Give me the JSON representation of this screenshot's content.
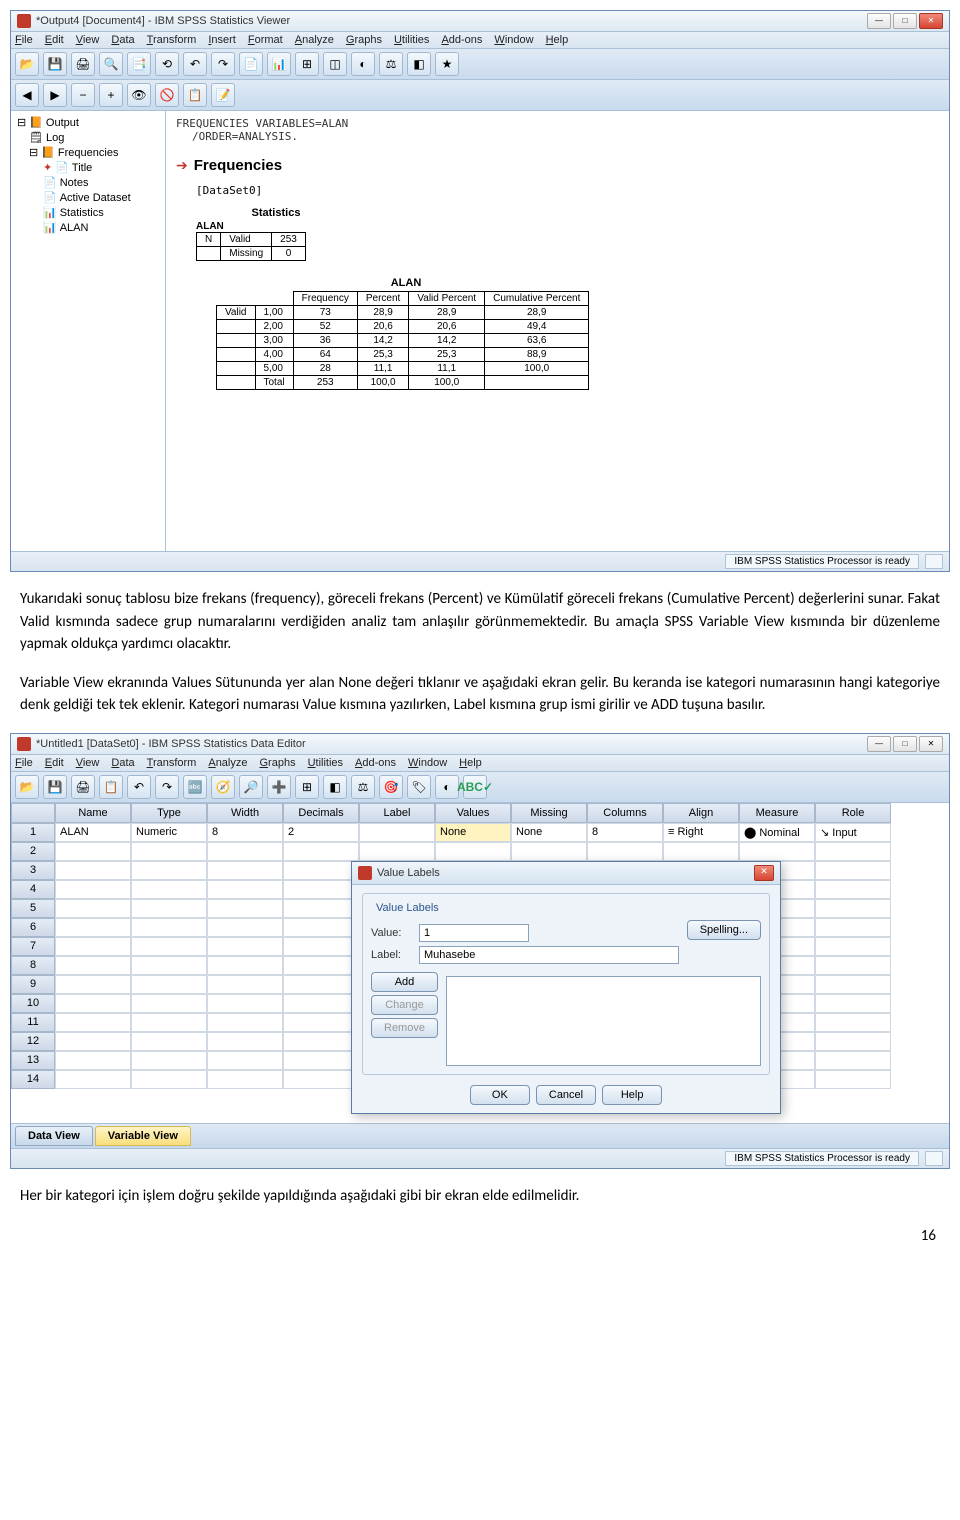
{
  "viewer": {
    "title": "*Output4 [Document4] - IBM SPSS Statistics Viewer",
    "menus": [
      "File",
      "Edit",
      "View",
      "Data",
      "Transform",
      "Insert",
      "Format",
      "Analyze",
      "Graphs",
      "Utilities",
      "Add-ons",
      "Window",
      "Help"
    ],
    "tree": {
      "root": "Output",
      "log": "Log",
      "freq": "Frequencies",
      "children": [
        "Title",
        "Notes",
        "Active Dataset",
        "Statistics",
        "ALAN"
      ]
    },
    "syntax_line1": "FREQUENCIES VARIABLES=ALAN",
    "syntax_line2": "/ORDER=ANALYSIS.",
    "freq_header": "Frequencies",
    "dataset": "[DataSet0]",
    "stats_caption": "Statistics",
    "stats_var": "ALAN",
    "stats_rows": {
      "n": "N",
      "valid": "Valid",
      "valid_n": "253",
      "missing": "Missing",
      "missing_n": "0"
    },
    "chart_data": {
      "type": "table",
      "title": "ALAN",
      "headers": [
        "",
        "",
        "Frequency",
        "Percent",
        "Valid Percent",
        "Cumulative Percent"
      ],
      "rows": [
        [
          "Valid",
          "1,00",
          "73",
          "28,9",
          "28,9",
          "28,9"
        ],
        [
          "",
          "2,00",
          "52",
          "20,6",
          "20,6",
          "49,4"
        ],
        [
          "",
          "3,00",
          "36",
          "14,2",
          "14,2",
          "63,6"
        ],
        [
          "",
          "4,00",
          "64",
          "25,3",
          "25,3",
          "88,9"
        ],
        [
          "",
          "5,00",
          "28",
          "11,1",
          "11,1",
          "100,0"
        ],
        [
          "",
          "Total",
          "253",
          "100,0",
          "100,0",
          ""
        ]
      ]
    },
    "status": "IBM SPSS Statistics Processor is ready"
  },
  "para1": "Yukarıdaki sonuç tablosu bize frekans (frequency), göreceli frekans (Percent) ve Kümülatif göreceli frekans (Cumulative Percent) değerlerini sunar. Fakat Valid kısmında sadece grup numaralarını verdiğiden analiz tam anlaşılır görünmemektedir. Bu amaçla SPSS Variable View kısmında bir düzenleme yapmak oldukça yardımcı olacaktır.",
  "para2": "Variable View ekranında Values Sütununda yer alan None değeri tıklanır ve aşağıdaki ekran gelir. Bu keranda ise kategori numarasının hangi kategoriye denk geldiği tek tek eklenir. Kategori numarası Value kısmına yazılırken, Label kısmına grup ismi girilir ve ADD tuşuna basılır.",
  "editor": {
    "title": "*Untitled1 [DataSet0] - IBM SPSS Statistics Data Editor",
    "menus": [
      "File",
      "Edit",
      "View",
      "Data",
      "Transform",
      "Analyze",
      "Graphs",
      "Utilities",
      "Add-ons",
      "Window",
      "Help"
    ],
    "columns": [
      "Name",
      "Type",
      "Width",
      "Decimals",
      "Label",
      "Values",
      "Missing",
      "Columns",
      "Align",
      "Measure",
      "Role"
    ],
    "row1": {
      "name": "ALAN",
      "type": "Numeric",
      "width": "8",
      "decimals": "2",
      "label": "",
      "values": "None",
      "missing": "None",
      "columns": "8",
      "align": "Right",
      "measure": "Nominal",
      "role": "Input"
    },
    "rows": 14,
    "tabs": {
      "data": "Data View",
      "variable": "Variable View"
    },
    "status": "IBM SPSS Statistics Processor is ready"
  },
  "dialog": {
    "title": "Value Labels",
    "groupbox": "Value Labels",
    "value_label": "Value:",
    "value_input": "1",
    "label_label": "Label:",
    "label_input": "Muhasebe",
    "spelling": "Spelling...",
    "add": "Add",
    "change": "Change",
    "remove": "Remove",
    "ok": "OK",
    "cancel": "Cancel",
    "help": "Help"
  },
  "para3": "Her bir kategori için işlem doğru şekilde yapıldığında aşağıdaki gibi bir ekran elde edilmelidir.",
  "page_number": "16"
}
